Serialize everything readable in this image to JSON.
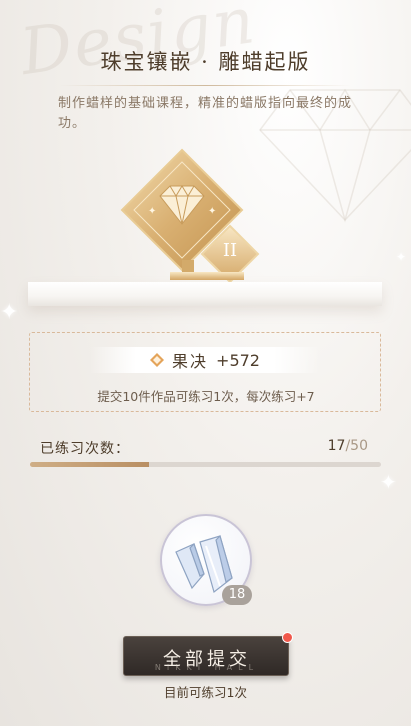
{
  "watermark": "Design",
  "header": {
    "title": "珠宝镶嵌 · 雕蜡起版",
    "description": "制作蜡样的基础课程，精准的蜡版指向最终的成功。"
  },
  "trophy": {
    "rank_label": "II",
    "icon": "diamond-trophy-icon"
  },
  "reward": {
    "icon": "decisiveness-icon",
    "name": "果决",
    "value": "+572",
    "rule": "提交10件作品可练习1次，每次练习+7"
  },
  "progress": {
    "label": "已练习次数：",
    "current": "17",
    "separator": "/",
    "total": "50",
    "fraction": 0.34
  },
  "item": {
    "icon": "crystal-material-icon",
    "count": "18"
  },
  "submit": {
    "label": "全部提交",
    "sub_label": "NIKKI HALL",
    "has_notification": true
  },
  "remaining_text": "目前可练习1次",
  "colors": {
    "accent_gold": "#c9a574",
    "button_dark": "#3a332f",
    "notification_red": "#f0584b"
  }
}
